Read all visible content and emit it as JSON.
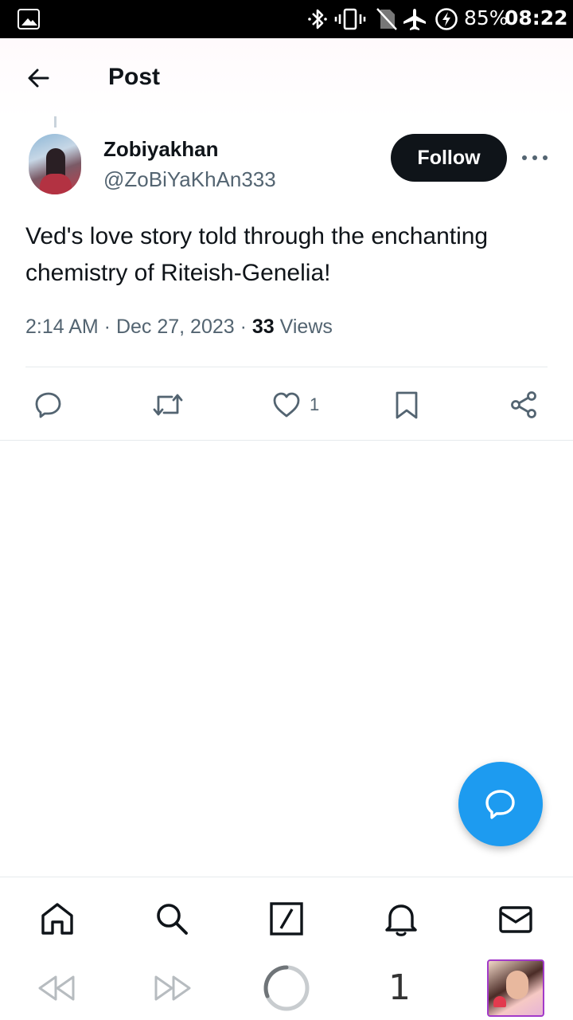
{
  "status_bar": {
    "battery": "85%",
    "time": "08:22",
    "icons": [
      "gallery-icon",
      "bluetooth-icon",
      "vibrate-icon",
      "no-sim-icon",
      "airplane-icon",
      "battery-charging-icon"
    ]
  },
  "header": {
    "title": "Post",
    "back_icon": "arrow-left-icon"
  },
  "post": {
    "author_name": "Zobiyakhan",
    "author_handle": "@ZoBiYaKhAn333",
    "follow_label": "Follow",
    "text": "Ved's love story told through the enchanting chemistry of Riteish-Genelia!",
    "time": "2:14 AM",
    "date": "Dec 27, 2023",
    "views_count": "33",
    "views_label": "Views"
  },
  "actions": {
    "like_count": "1",
    "icons": [
      "reply-icon",
      "retweet-icon",
      "like-icon",
      "bookmark-icon",
      "share-icon"
    ]
  },
  "bottom_nav": {
    "items": [
      "home-icon",
      "search-icon",
      "grok-icon",
      "notifications-icon",
      "messages-icon"
    ]
  },
  "browser_bar": {
    "tab_count": "1",
    "icons": [
      "rewind-icon",
      "fast-forward-icon",
      "loading-icon",
      "profile-thumbnail"
    ]
  },
  "colors": {
    "accent": "#1d9bf0",
    "text_primary": "#0f1419",
    "text_secondary": "#536471",
    "follow_bg": "#0f1419"
  }
}
